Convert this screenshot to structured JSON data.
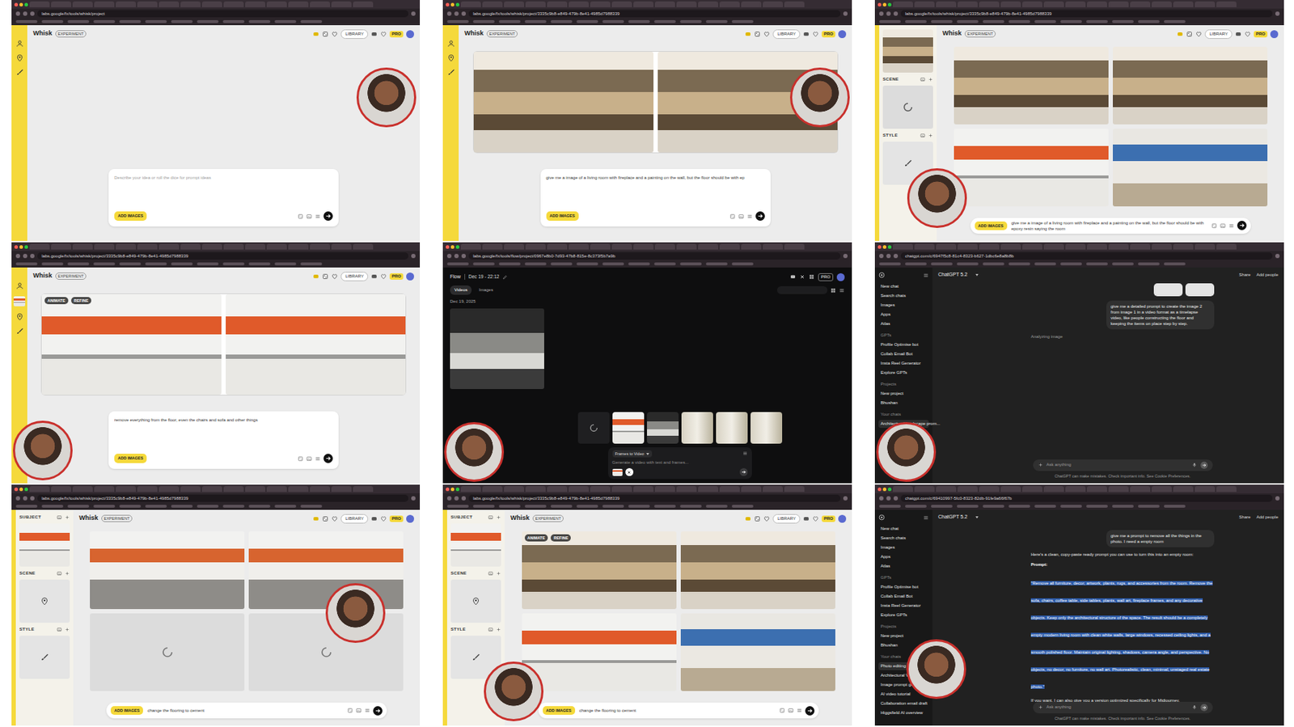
{
  "whisk": {
    "app": "Whisk",
    "badge": "EXPERIMENT",
    "library": "LIBRARY",
    "plan": "PRO",
    "add_images": "ADD IMAGES",
    "animate": "ANIMATE",
    "refine": "REFINE"
  },
  "panels": [
    {
      "kind": "whisk",
      "url": "labs.google/fx/tools/whisk/project",
      "side": {
        "kind": "icons"
      },
      "prompt_style": "card",
      "placeholder": "Describe your idea or roll the dice for prompt ideas",
      "images": []
    },
    {
      "kind": "whisk",
      "url": "labs.google/fx/tools/whisk/project/3335c9b8-e849-479b-8e41-4985d7988339",
      "side": {
        "kind": "icons"
      },
      "prompt_style": "card",
      "prompt": "give me a image of a living room with fireplace and a painting on the wall, but the floor should be with ep",
      "images": [
        {
          "kind": "classic",
          "toolbar": false
        },
        {
          "kind": "classic",
          "toolbar": false
        }
      ]
    },
    {
      "kind": "whisk",
      "url": "labs.google/fx/tools/whisk/project/3335c9b8-e849-479b-8e41-4985d7988339",
      "side": {
        "kind": "full",
        "sections": [
          {
            "thumb": "classic"
          },
          {
            "label": "SCENE",
            "thumb": "loading"
          },
          {
            "label": "STYLE",
            "thumb": "empty"
          }
        ]
      },
      "prompt_style": "bar",
      "prompt": "give me a image of a living room with fireplace and a painting on the wall, but the floor should be with epoxy resin saying the room",
      "images": [
        {
          "kind": "classic",
          "toolbar": false
        },
        {
          "kind": "classic",
          "toolbar": false
        },
        {
          "kind": "modern",
          "toolbar": false
        },
        {
          "kind": "gallery",
          "toolbar": false
        }
      ]
    },
    {
      "kind": "whisk",
      "url": "labs.google/fx/tools/whisk/project/3335c9b8-e849-479b-8e41-4985d7988339",
      "side": {
        "kind": "icons",
        "thumb": "modern"
      },
      "prompt_style": "card",
      "prompt": "remove everything from the floor, even the chairs and sofa and other things",
      "images": [
        {
          "kind": "modern",
          "toolbar": true
        },
        {
          "kind": "modern",
          "toolbar": false
        }
      ]
    },
    {
      "kind": "flow",
      "url": "labs.google/fx/tools/flow/project/0967e8b0-7d93-47b8-815e-8c373f5b7a9b",
      "crumb": "Flow",
      "title": "Dec 19 - 22:12",
      "plan": "PRO",
      "tabs": [
        {
          "label": "Videos",
          "selected": true
        },
        {
          "label": "Images",
          "selected": false
        }
      ],
      "date": "Dec 19, 2025",
      "video": "kitchen",
      "uploads": [
        {
          "kind": "loading"
        },
        {
          "kind": "modern"
        },
        {
          "kind": "kitchen"
        },
        {
          "kind": "arch"
        },
        {
          "kind": "arch"
        },
        {
          "kind": "arch"
        }
      ],
      "mode": "Frames to Video",
      "composer": "Generate a video with text and frames..."
    },
    {
      "kind": "chatgpt",
      "url": "chatgpt.com/c/6947f5c8-81c4-8323-b627-1dbc6e8a8b8b",
      "model": "ChatGPT 5.2",
      "share": "Share",
      "add_people": "Add people",
      "sidebar": [
        {
          "kind": "item",
          "label": "New chat",
          "selected": false
        },
        {
          "kind": "item",
          "label": "Search chats",
          "selected": false
        },
        {
          "kind": "item",
          "label": "Images",
          "selected": false
        },
        {
          "kind": "item",
          "label": "Apps",
          "selected": false
        },
        {
          "kind": "item",
          "label": "Atlas",
          "selected": false
        },
        {
          "kind": "heading",
          "label": "GPTs",
          "selected": false
        },
        {
          "kind": "item",
          "label": "Profile Optimise bot",
          "selected": false
        },
        {
          "kind": "item",
          "label": "Collab Email Bot",
          "selected": false
        },
        {
          "kind": "item",
          "label": "Insta Reel Generator",
          "selected": false
        },
        {
          "kind": "item",
          "label": "Explore GPTs",
          "selected": false
        },
        {
          "kind": "heading",
          "label": "Projects",
          "selected": false
        },
        {
          "kind": "item",
          "label": "New project",
          "selected": false
        },
        {
          "kind": "item",
          "label": "Bhushan",
          "selected": false
        },
        {
          "kind": "heading",
          "label": "Your chats",
          "selected": false
        },
        {
          "kind": "item",
          "label": "Architectural landscape prom...",
          "selected": true
        }
      ],
      "messages": [
        {
          "role": "images",
          "items": [
            {
              "kind": "empty"
            },
            {
              "kind": "empty"
            }
          ]
        },
        {
          "role": "user",
          "text": "give me a detailed prompt to create the image 2 from image 1 in a video format as a timelapse video, like people constructing the floor and keeping the items on place step by step."
        },
        {
          "role": "status",
          "text": "Analyzing image"
        }
      ],
      "composer": "Ask anything",
      "footer": "ChatGPT can make mistakes. Check important info. See Cookie Preferences."
    },
    {
      "kind": "whisk",
      "url": "labs.google/fx/tools/whisk/project/3335c9b8-e849-479b-8e41-4985d7988339",
      "side": {
        "kind": "full",
        "sections": [
          {
            "label": "SUBJECT",
            "thumb": "modern"
          },
          {
            "label": "SCENE",
            "thumb": "empty"
          },
          {
            "label": "STYLE",
            "thumb": "empty"
          }
        ]
      },
      "prompt_style": "bar",
      "prompt": "change the flooring to cement",
      "images": [
        {
          "kind": "cement",
          "toolbar": false
        },
        {
          "kind": "cement",
          "toolbar": false
        },
        {
          "kind": "loading",
          "toolbar": false
        },
        {
          "kind": "loading",
          "toolbar": false
        }
      ]
    },
    {
      "kind": "whisk",
      "url": "labs.google/fx/tools/whisk/project/3335c9b8-e849-479b-8e41-4985d7988339",
      "side": {
        "kind": "full",
        "sections": [
          {
            "label": "SUBJECT",
            "thumb": "modern"
          },
          {
            "label": "SCENE",
            "thumb": "empty"
          },
          {
            "label": "STYLE",
            "thumb": "empty"
          }
        ]
      },
      "prompt_style": "bar",
      "prompt": "change the flooring to cement",
      "images": [
        {
          "kind": "classic",
          "toolbar": true
        },
        {
          "kind": "classic",
          "toolbar": false
        },
        {
          "kind": "modern",
          "toolbar": false
        },
        {
          "kind": "gallery",
          "toolbar": false
        }
      ]
    },
    {
      "kind": "chatgpt",
      "url": "chatgpt.com/c/69410997-5fc0-8323-82db-91fe9a66f67b",
      "model": "ChatGPT 5.2",
      "share": "Share",
      "add_people": "Add people",
      "sidebar": [
        {
          "kind": "item",
          "label": "New chat",
          "selected": false
        },
        {
          "kind": "item",
          "label": "Search chats",
          "selected": false
        },
        {
          "kind": "item",
          "label": "Images",
          "selected": false
        },
        {
          "kind": "item",
          "label": "Apps",
          "selected": false
        },
        {
          "kind": "item",
          "label": "Atlas",
          "selected": false
        },
        {
          "kind": "heading",
          "label": "GPTs",
          "selected": false
        },
        {
          "kind": "item",
          "label": "Profile Optimise bot",
          "selected": false
        },
        {
          "kind": "item",
          "label": "Collab Email Bot",
          "selected": false
        },
        {
          "kind": "item",
          "label": "Insta Reel Generator",
          "selected": false
        },
        {
          "kind": "item",
          "label": "Explore GPTs",
          "selected": false
        },
        {
          "kind": "heading",
          "label": "Projects",
          "selected": false
        },
        {
          "kind": "item",
          "label": "New project",
          "selected": false
        },
        {
          "kind": "item",
          "label": "Bhushan",
          "selected": false
        },
        {
          "kind": "heading",
          "label": "Your chats",
          "selected": false
        },
        {
          "kind": "item",
          "label": "Photo editing prompt",
          "selected": true
        },
        {
          "kind": "item",
          "label": "Architectural Visualiza...",
          "selected": false
        },
        {
          "kind": "item",
          "label": "Image prompt generati...",
          "selected": false
        },
        {
          "kind": "item",
          "label": "AI video tutorial",
          "selected": false
        },
        {
          "kind": "item",
          "label": "Collaboration email draft",
          "selected": false
        },
        {
          "kind": "item",
          "label": "Higgsfield AI overview",
          "selected": false
        }
      ],
      "messages": [
        {
          "role": "image",
          "kind": "modern"
        },
        {
          "role": "user",
          "text": "give me a prompt to remove all the things in the photo. I need a empty room"
        },
        {
          "role": "assistant",
          "text": "Here's a clean, copy-paste ready prompt you can use to turn this into an empty room:"
        },
        {
          "role": "label",
          "text": "Prompt:"
        },
        {
          "role": "highlight",
          "selected": true,
          "text": "\"Remove all furniture, decor, artwork, plants, rugs, and accessories from the room. Remove the sofa, chairs, coffee table, side tables, plants, wall art, fireplace frames, and any decorative objects. Keep only the architectural structure of the space. The result should be a completely empty modern living room with clean white walls, large windows, recessed ceiling lights, and a smooth polished floor. Maintain original lighting, shadows, camera angle, and perspective. No objects, no decor, no furniture, no wall art. Photorealistic, clean, minimal, unstaged real estate photo.\""
        },
        {
          "role": "assistant",
          "text": "If you want, I can also give you a version optimized specifically for Midjourney."
        }
      ],
      "composer": "Ask anything",
      "footer": "ChatGPT can make mistakes. Check important info. See Cookie Preferences."
    }
  ]
}
